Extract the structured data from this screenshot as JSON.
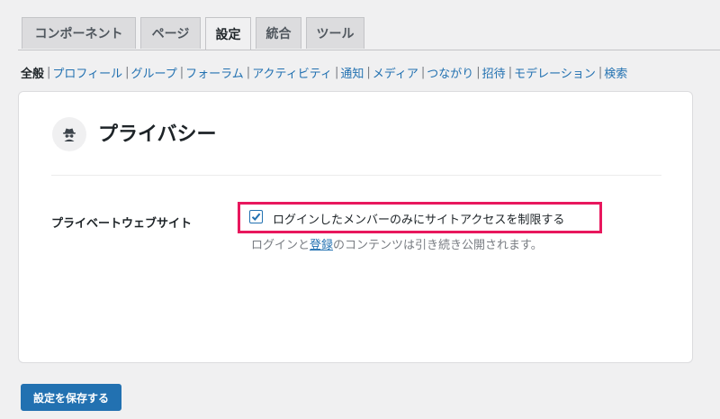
{
  "tabs": [
    {
      "label": "コンポーネント",
      "active": false
    },
    {
      "label": "ページ",
      "active": false
    },
    {
      "label": "設定",
      "active": true
    },
    {
      "label": "統合",
      "active": false
    },
    {
      "label": "ツール",
      "active": false
    }
  ],
  "subnav": {
    "current": "全般",
    "links": [
      "プロフィール",
      "グループ",
      "フォーラム",
      "アクティビティ",
      "通知",
      "メディア",
      "つながり",
      "招待",
      "モデレーション",
      "検索"
    ]
  },
  "card": {
    "icon": "incognito-spy-icon",
    "title": "プライバシー",
    "field_label": "プライベートウェブサイト",
    "checkbox_label": "ログインしたメンバーのみにサイトアクセスを制限する",
    "checkbox_checked": true,
    "help_prefix": "ログインと",
    "help_link": "登録",
    "help_suffix": "のコンテンツは引き続き公開されます。"
  },
  "save_button": "設定を保存する",
  "colors": {
    "accent": "#2271b1",
    "highlight": "#e8175d",
    "background": "#f0f0f1"
  }
}
